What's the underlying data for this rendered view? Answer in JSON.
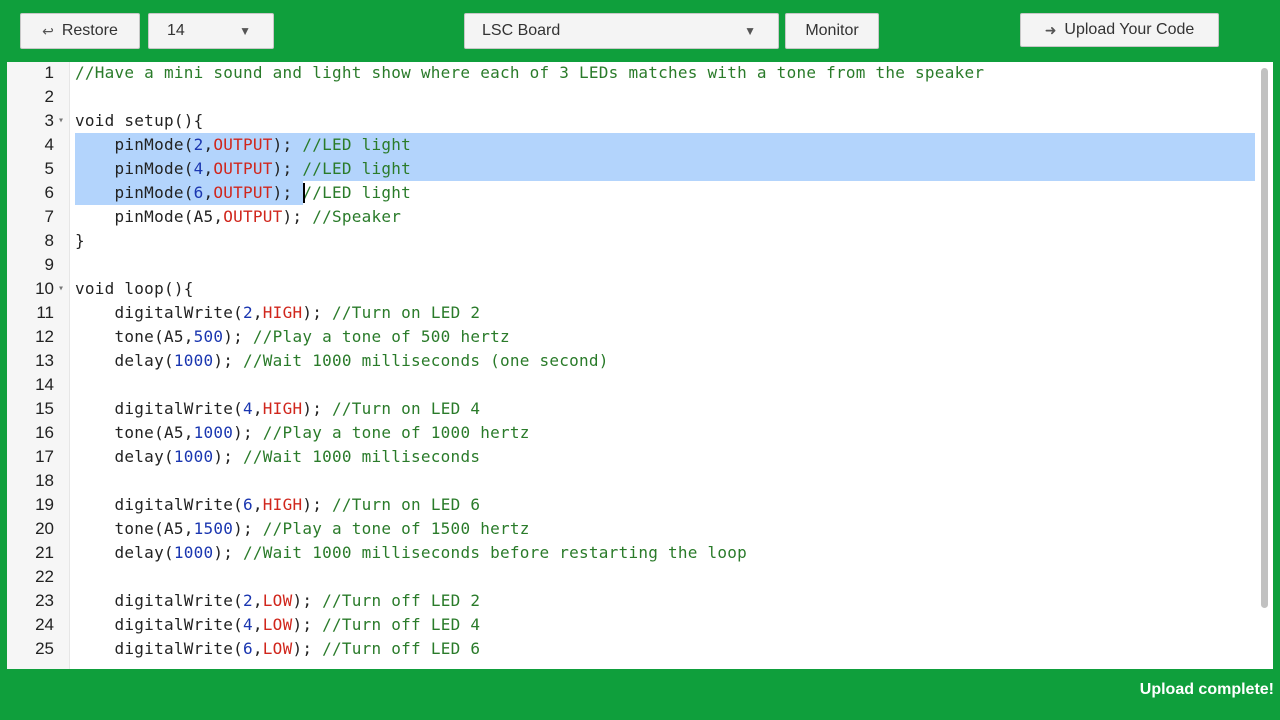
{
  "toolbar": {
    "restore_label": "Restore",
    "board_number": "14",
    "board_name": "LSC Board",
    "monitor_label": "Monitor",
    "upload_label": "Upload Your Code"
  },
  "editor": {
    "lines": [
      {
        "n": "1",
        "tokens": [
          [
            "comment",
            "//Have a mini sound and light show where each of 3 LEDs matches with a tone from the speaker"
          ]
        ]
      },
      {
        "n": "2",
        "tokens": []
      },
      {
        "n": "3",
        "fold": true,
        "tokens": [
          [
            "kw",
            "void setup(){"
          ]
        ]
      },
      {
        "n": "4",
        "tokens": [
          [
            "kw",
            "    pinMode("
          ],
          [
            "num",
            "2"
          ],
          [
            "kw",
            ","
          ],
          [
            "const",
            "OUTPUT"
          ],
          [
            "kw",
            "); "
          ],
          [
            "comment",
            "//LED light"
          ]
        ]
      },
      {
        "n": "5",
        "tokens": [
          [
            "kw",
            "    pinMode("
          ],
          [
            "num",
            "4"
          ],
          [
            "kw",
            ","
          ],
          [
            "const",
            "OUTPUT"
          ],
          [
            "kw",
            "); "
          ],
          [
            "comment",
            "//LED light"
          ]
        ]
      },
      {
        "n": "6",
        "tokens": [
          [
            "kw",
            "    pinMode("
          ],
          [
            "num",
            "6"
          ],
          [
            "kw",
            ","
          ],
          [
            "const",
            "OUTPUT"
          ],
          [
            "kw",
            "); "
          ],
          [
            "comment",
            "//LED light"
          ]
        ]
      },
      {
        "n": "7",
        "tokens": [
          [
            "kw",
            "    pinMode(A5,"
          ],
          [
            "const",
            "OUTPUT"
          ],
          [
            "kw",
            "); "
          ],
          [
            "comment",
            "//Speaker"
          ]
        ]
      },
      {
        "n": "8",
        "tokens": [
          [
            "kw",
            "}"
          ]
        ]
      },
      {
        "n": "9",
        "tokens": []
      },
      {
        "n": "10",
        "fold": true,
        "tokens": [
          [
            "kw",
            "void loop(){"
          ]
        ]
      },
      {
        "n": "11",
        "tokens": [
          [
            "kw",
            "    digitalWrite("
          ],
          [
            "num",
            "2"
          ],
          [
            "kw",
            ","
          ],
          [
            "const",
            "HIGH"
          ],
          [
            "kw",
            "); "
          ],
          [
            "comment",
            "//Turn on LED 2"
          ]
        ]
      },
      {
        "n": "12",
        "tokens": [
          [
            "kw",
            "    tone(A5,"
          ],
          [
            "num",
            "500"
          ],
          [
            "kw",
            "); "
          ],
          [
            "comment",
            "//Play a tone of 500 hertz"
          ]
        ]
      },
      {
        "n": "13",
        "tokens": [
          [
            "kw",
            "    delay("
          ],
          [
            "num",
            "1000"
          ],
          [
            "kw",
            "); "
          ],
          [
            "comment",
            "//Wait 1000 milliseconds (one second)"
          ]
        ]
      },
      {
        "n": "14",
        "tokens": []
      },
      {
        "n": "15",
        "tokens": [
          [
            "kw",
            "    digitalWrite("
          ],
          [
            "num",
            "4"
          ],
          [
            "kw",
            ","
          ],
          [
            "const",
            "HIGH"
          ],
          [
            "kw",
            "); "
          ],
          [
            "comment",
            "//Turn on LED 4"
          ]
        ]
      },
      {
        "n": "16",
        "tokens": [
          [
            "kw",
            "    tone(A5,"
          ],
          [
            "num",
            "1000"
          ],
          [
            "kw",
            "); "
          ],
          [
            "comment",
            "//Play a tone of 1000 hertz"
          ]
        ]
      },
      {
        "n": "17",
        "tokens": [
          [
            "kw",
            "    delay("
          ],
          [
            "num",
            "1000"
          ],
          [
            "kw",
            "); "
          ],
          [
            "comment",
            "//Wait 1000 milliseconds"
          ]
        ]
      },
      {
        "n": "18",
        "tokens": []
      },
      {
        "n": "19",
        "tokens": [
          [
            "kw",
            "    digitalWrite("
          ],
          [
            "num",
            "6"
          ],
          [
            "kw",
            ","
          ],
          [
            "const",
            "HIGH"
          ],
          [
            "kw",
            "); "
          ],
          [
            "comment",
            "//Turn on LED 6"
          ]
        ]
      },
      {
        "n": "20",
        "tokens": [
          [
            "kw",
            "    tone(A5,"
          ],
          [
            "num",
            "1500"
          ],
          [
            "kw",
            "); "
          ],
          [
            "comment",
            "//Play a tone of 1500 hertz"
          ]
        ]
      },
      {
        "n": "21",
        "tokens": [
          [
            "kw",
            "    delay("
          ],
          [
            "num",
            "1000"
          ],
          [
            "kw",
            "); "
          ],
          [
            "comment",
            "//Wait 1000 milliseconds before restarting the loop"
          ]
        ]
      },
      {
        "n": "22",
        "tokens": []
      },
      {
        "n": "23",
        "tokens": [
          [
            "kw",
            "    digitalWrite("
          ],
          [
            "num",
            "2"
          ],
          [
            "kw",
            ","
          ],
          [
            "const",
            "LOW"
          ],
          [
            "kw",
            "); "
          ],
          [
            "comment",
            "//Turn off LED 2"
          ]
        ]
      },
      {
        "n": "24",
        "tokens": [
          [
            "kw",
            "    digitalWrite("
          ],
          [
            "num",
            "4"
          ],
          [
            "kw",
            ","
          ],
          [
            "const",
            "LOW"
          ],
          [
            "kw",
            "); "
          ],
          [
            "comment",
            "//Turn off LED 4"
          ]
        ]
      },
      {
        "n": "25",
        "tokens": [
          [
            "kw",
            "    digitalWrite("
          ],
          [
            "num",
            "6"
          ],
          [
            "kw",
            ","
          ],
          [
            "const",
            "LOW"
          ],
          [
            "kw",
            "); "
          ],
          [
            "comment",
            "//Turn off LED 6"
          ]
        ]
      }
    ]
  },
  "status": {
    "message": "Upload complete!"
  },
  "colors": {
    "accent": "#0f9f3c",
    "selection": "#b3d4fc",
    "comment": "#2a7b2a",
    "number": "#1a36b0",
    "constant": "#d0261c"
  }
}
